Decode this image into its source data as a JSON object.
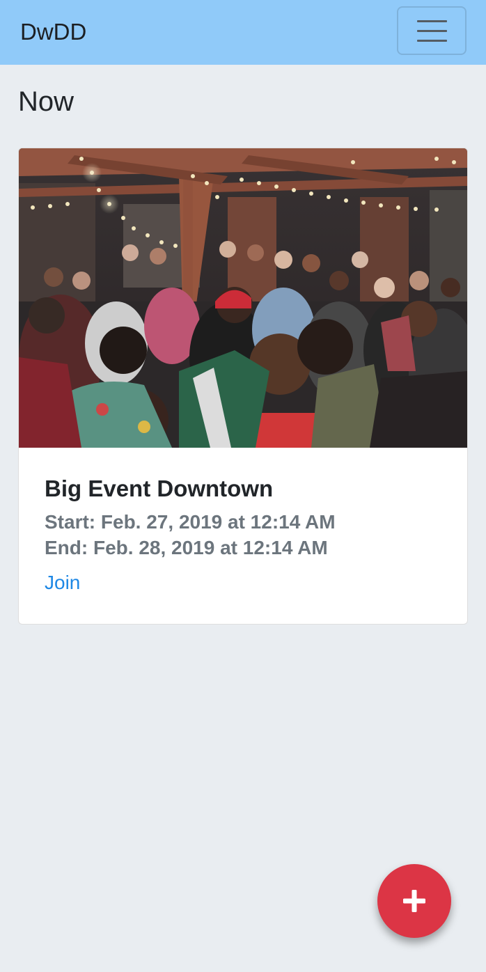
{
  "navbar": {
    "brand": "DwDD",
    "toggle_icon": "hamburger-menu-icon",
    "background_color": "#90caf9"
  },
  "section": {
    "title": "Now"
  },
  "events": [
    {
      "title": "Big Event Downtown",
      "start": "Start: Feb. 27, 2019 at 12:14 AM",
      "end": "End: Feb. 28, 2019 at 12:14 AM",
      "action_label": "Join",
      "image": "photo of a crowd of people at an outdoor party under string lights"
    }
  ],
  "fab": {
    "icon": "plus-icon",
    "color": "#dc3545"
  },
  "colors": {
    "page_background": "#e9edf1",
    "link": "#1e88e5",
    "muted_text": "#6c757d"
  }
}
